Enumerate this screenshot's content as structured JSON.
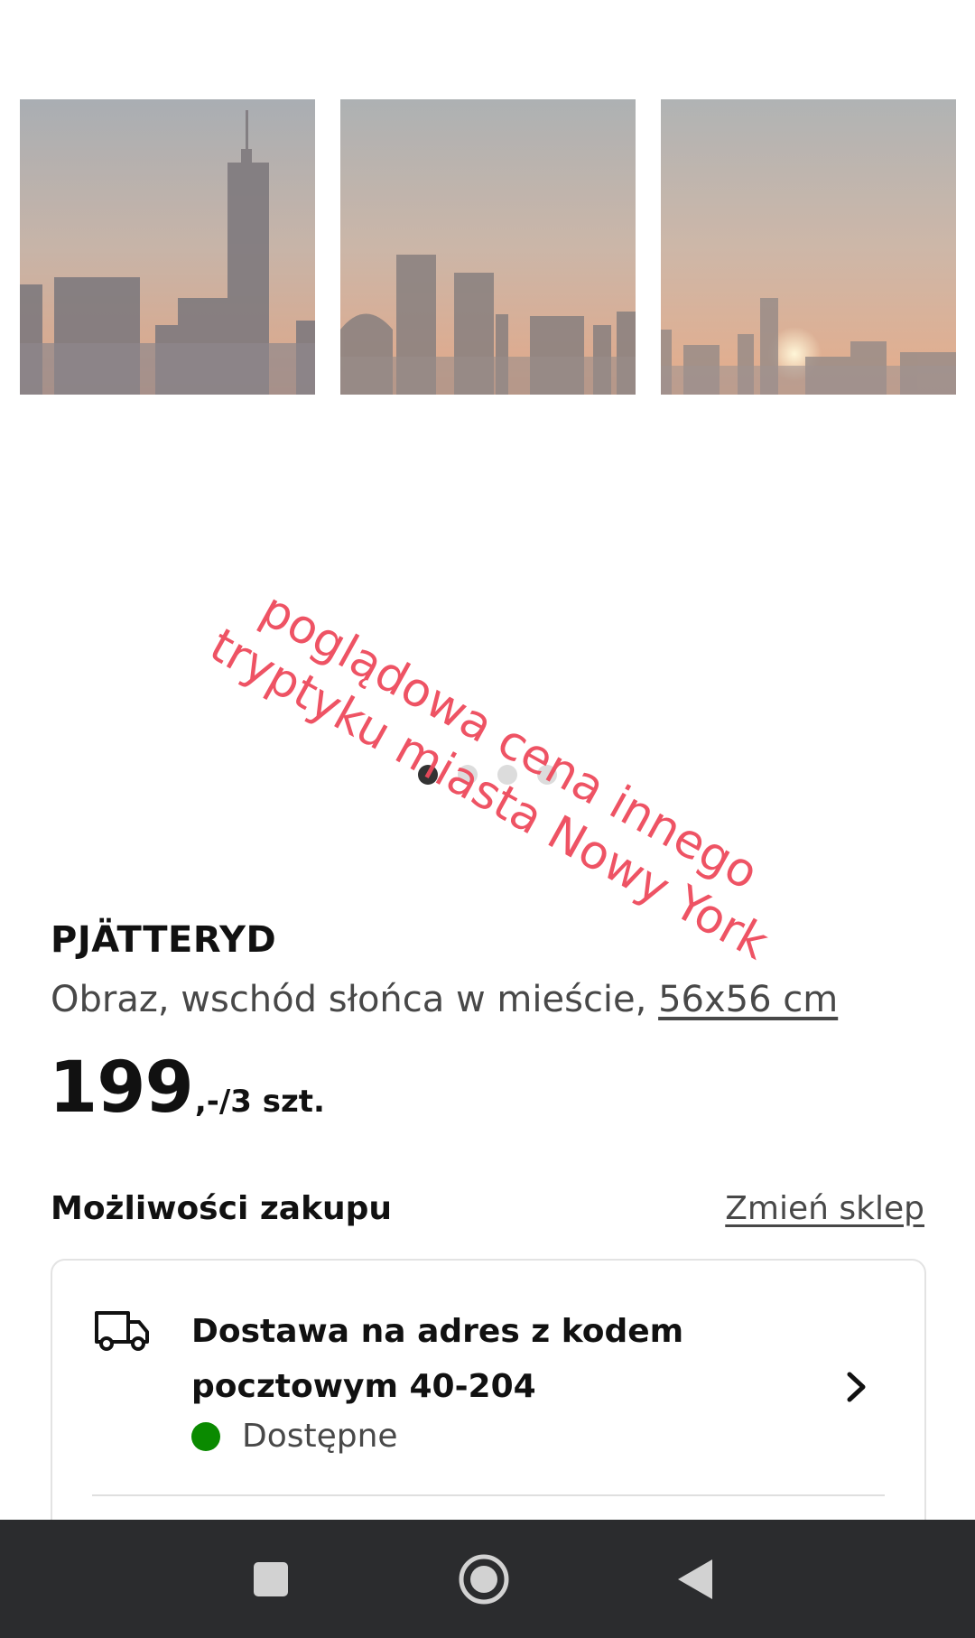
{
  "overlay": {
    "line1": "poglądowa cena innego",
    "line2": "tryptyku miasta Nowy York"
  },
  "carousel": {
    "total": 4,
    "active": 1
  },
  "product": {
    "name": "PJÄTTERYD",
    "description_prefix": "Obraz, wschód słońca w mieście, ",
    "size": "56x56 cm",
    "price_main": "199",
    "price_suffix": ",-/3 szt."
  },
  "purchase": {
    "title": "Możliwości zakupu",
    "change_store": "Zmień sklep",
    "delivery_line1": "Dostawa na adres z kodem",
    "delivery_line2": "pocztowym 40-204",
    "availability": "Dostępne"
  },
  "colors": {
    "overlay_text": "#ee4a5c",
    "available": "#0a8a00",
    "navbar": "#2b2c2e"
  },
  "icons": [
    "truck-icon",
    "chevron-right-icon",
    "recent-apps-icon",
    "home-icon",
    "back-icon"
  ]
}
